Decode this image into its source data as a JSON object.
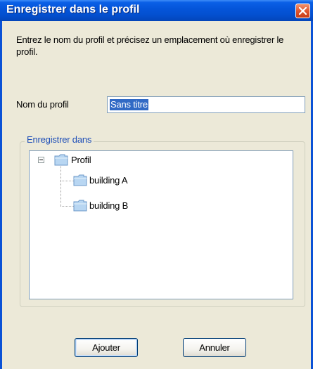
{
  "window": {
    "title": "Enregistrer dans le profil",
    "title_color": "#ffffff",
    "titlebar_color": "#0454d8",
    "background_color": "#ece9d8"
  },
  "instructions": "Entrez le nom du profil et précisez un emplacement où enregistrer le profil.",
  "profile_name": {
    "label": "Nom du profil",
    "value": "Sans titre"
  },
  "save_in": {
    "legend": "Enregistrer dans",
    "tree": {
      "root": {
        "label": "Profil",
        "icon": "folder-icon",
        "expanded": true
      },
      "children": [
        {
          "label": "building A",
          "icon": "folder-icon"
        },
        {
          "label": "building B",
          "icon": "folder-icon"
        }
      ]
    }
  },
  "buttons": {
    "add": "Ajouter",
    "cancel": "Annuler"
  },
  "icons": {
    "close": "close-icon",
    "expander": "collapse-icon",
    "folder": "folder-icon"
  }
}
